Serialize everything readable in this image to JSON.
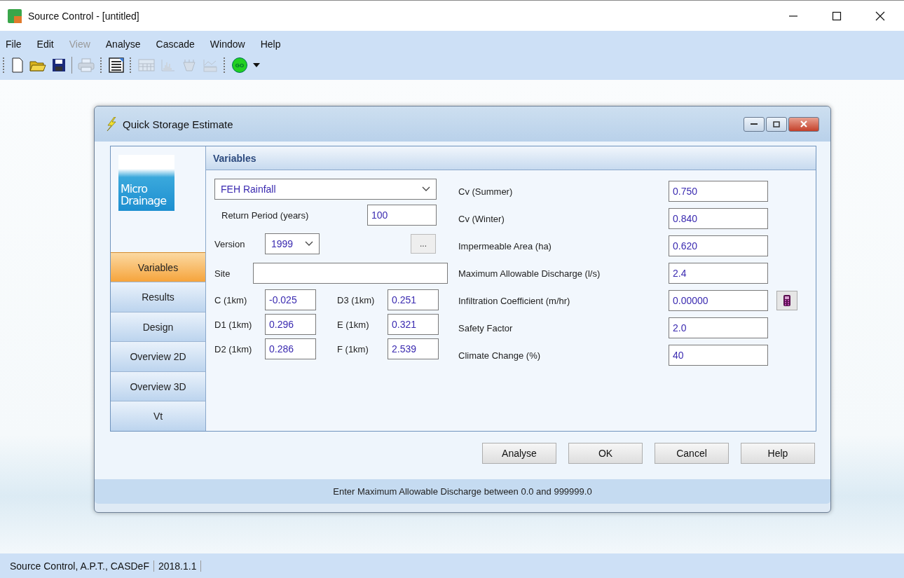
{
  "window": {
    "title": "Source Control - [untitled]"
  },
  "menu": [
    {
      "label": "File",
      "disabled": false
    },
    {
      "label": "Edit",
      "disabled": false
    },
    {
      "label": "View",
      "disabled": true
    },
    {
      "label": "Analyse",
      "disabled": false
    },
    {
      "label": "Cascade",
      "disabled": false
    },
    {
      "label": "Window",
      "disabled": false
    },
    {
      "label": "Help",
      "disabled": false
    }
  ],
  "toolbar": [
    {
      "kind": "grip"
    },
    {
      "kind": "new",
      "disabled": false
    },
    {
      "kind": "open",
      "disabled": false
    },
    {
      "kind": "save",
      "disabled": false
    },
    {
      "kind": "separator"
    },
    {
      "kind": "print",
      "disabled": true
    },
    {
      "kind": "grip"
    },
    {
      "kind": "report",
      "disabled": false
    },
    {
      "kind": "grip"
    },
    {
      "kind": "sum",
      "disabled": true
    },
    {
      "kind": "chart",
      "disabled": true
    },
    {
      "kind": "tank",
      "disabled": true
    },
    {
      "kind": "graph",
      "disabled": true
    },
    {
      "kind": "grip"
    },
    {
      "kind": "go",
      "disabled": false,
      "text": "GO"
    },
    {
      "kind": "caret",
      "disabled": false
    }
  ],
  "dialog": {
    "title": "Quick Storage Estimate",
    "logo": {
      "line1": "Micro",
      "line2": "Drainage"
    },
    "nav": [
      {
        "label": "Variables",
        "selected": true
      },
      {
        "label": "Results",
        "selected": false
      },
      {
        "label": "Design",
        "selected": false
      },
      {
        "label": "Overview 2D",
        "selected": false
      },
      {
        "label": "Overview 3D",
        "selected": false
      },
      {
        "label": "Vt",
        "selected": false
      }
    ],
    "panel_title": "Variables",
    "rainfall": {
      "value": "FEH Rainfall"
    },
    "return_period": {
      "label": "Return Period (years)",
      "value": "100"
    },
    "version": {
      "label": "Version",
      "value": "1999",
      "button": "..."
    },
    "site": {
      "label": "Site"
    },
    "coefficients": [
      {
        "label": "C (1km)",
        "value": "-0.025"
      },
      {
        "label": "D3 (1km)",
        "value": "0.251"
      },
      {
        "label": "D1 (1km)",
        "value": "0.296"
      },
      {
        "label": "E (1km)",
        "value": "0.321"
      },
      {
        "label": "D2 (1km)",
        "value": "0.286"
      },
      {
        "label": "F (1km)",
        "value": "2.539"
      }
    ],
    "fields": [
      {
        "label": "Cv (Summer)",
        "value": "0.750",
        "kind": "plain"
      },
      {
        "label": "Cv (Winter)",
        "value": "0.840",
        "kind": "plain"
      },
      {
        "label": "Impermeable Area (ha)",
        "value": "0.620",
        "kind": "plain"
      },
      {
        "label": "Maximum Allowable Discharge (l/s)",
        "value": "2.4",
        "kind": "plain"
      },
      {
        "label": "Infiltration Coefficient (m/hr)",
        "value": "0.00000",
        "kind": "calculator"
      },
      {
        "label": "Safety Factor",
        "value": "2.0",
        "kind": "plain"
      },
      {
        "label": "Climate Change (%)",
        "value": "40",
        "kind": "plain"
      }
    ],
    "buttons": [
      "Analyse",
      "OK",
      "Cancel",
      "Help"
    ],
    "status": "Enter Maximum Allowable Discharge between 0.0 and 999999.0"
  },
  "status_bar": [
    "Source Control, A.P.T., CASDeF",
    "2018.1.1"
  ]
}
